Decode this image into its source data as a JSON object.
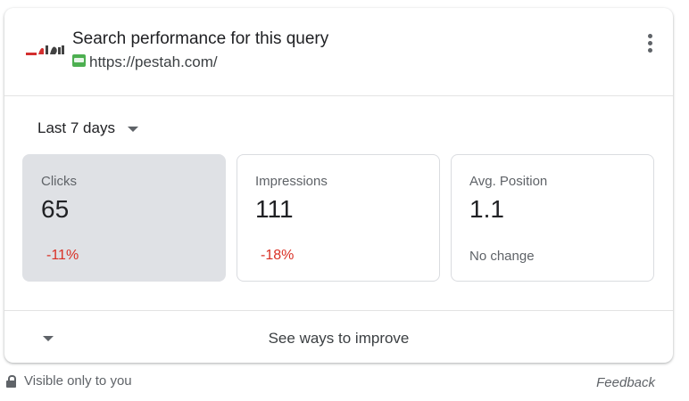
{
  "header": {
    "title": "Search performance for this query",
    "url": "https://pestah.com/",
    "logo_icon": "site-logo",
    "favicon_icon": "site-favicon",
    "menu_icon": "more-vert-icon"
  },
  "period": {
    "label": "Last 7 days",
    "icon": "caret-down-icon"
  },
  "metrics": [
    {
      "label": "Clicks",
      "value": "65",
      "change": "-11%",
      "selected": true
    },
    {
      "label": "Impressions",
      "value": "111",
      "change": "-18%",
      "selected": false
    },
    {
      "label": "Avg. Position",
      "value": "1.1",
      "change": "No change",
      "selected": false
    }
  ],
  "footer": {
    "label": "See ways to improve",
    "icon": "caret-down-icon"
  },
  "visibility": {
    "text": "Visible only to you",
    "icon": "lock-icon"
  },
  "feedback": {
    "label": "Feedback"
  },
  "colors": {
    "negative": "#d93025",
    "selected_bg": "#dfe1e5",
    "text": "#202124",
    "muted": "#5f6368"
  }
}
